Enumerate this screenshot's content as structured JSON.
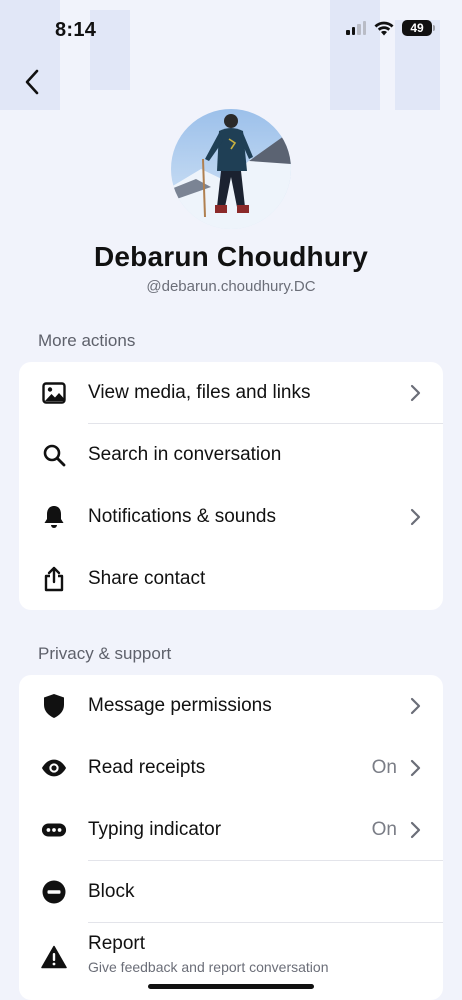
{
  "status_bar": {
    "time": "8:14",
    "battery": "49"
  },
  "profile": {
    "name": "Debarun Choudhury",
    "handle": "@debarun.choudhury.DC"
  },
  "more_actions": {
    "title": "More actions",
    "items": [
      {
        "label": "View media, files and links",
        "icon": "image-icon",
        "chevron": true
      },
      {
        "label": "Search in conversation",
        "icon": "search-icon",
        "chevron": false
      },
      {
        "label": "Notifications & sounds",
        "icon": "bell-icon",
        "chevron": true
      },
      {
        "label": "Share contact",
        "icon": "share-icon",
        "chevron": false
      }
    ]
  },
  "privacy_support": {
    "title": "Privacy & support",
    "items": [
      {
        "label": "Message permissions",
        "icon": "shield-icon",
        "chevron": true
      },
      {
        "label": "Read receipts",
        "value": "On",
        "icon": "eye-icon",
        "chevron": true
      },
      {
        "label": "Typing indicator",
        "value": "On",
        "icon": "typing-bubble-icon",
        "chevron": true
      },
      {
        "label": "Block",
        "icon": "block-icon",
        "chevron": false
      },
      {
        "label": "Report",
        "sublabel": "Give feedback and report conversation",
        "icon": "warning-icon",
        "chevron": false
      }
    ]
  },
  "colors": {
    "background": "#f1f3fb",
    "card": "#ffffff",
    "text_primary": "#111111",
    "text_secondary": "#6b6e78"
  }
}
